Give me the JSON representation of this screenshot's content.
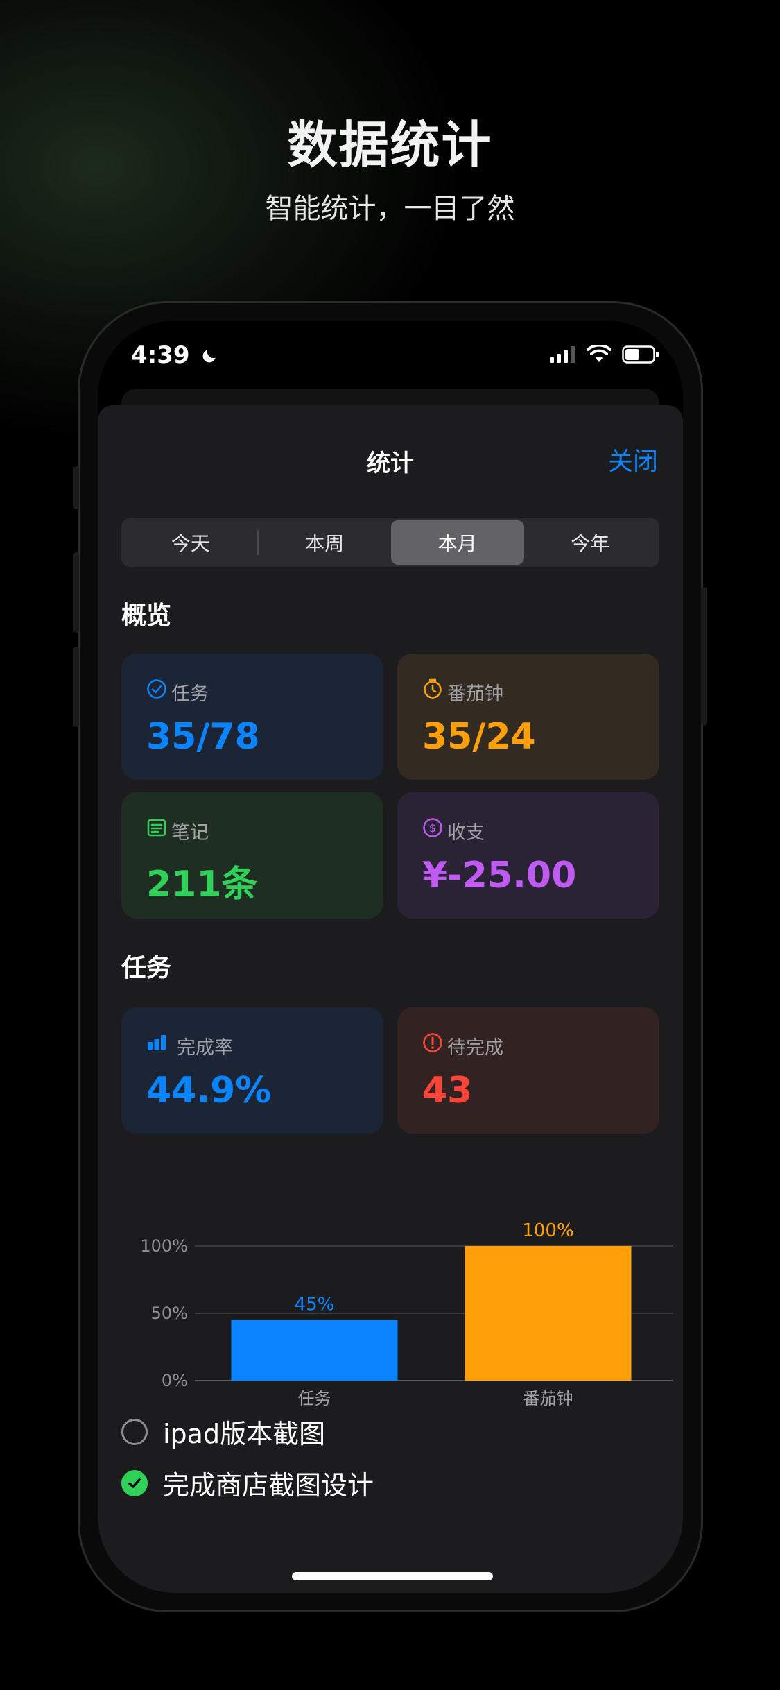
{
  "hero": {
    "title": "数据统计",
    "subtitle": "智能统计，一目了然"
  },
  "status": {
    "time": "4:39"
  },
  "nav": {
    "title": "统计",
    "close": "关闭"
  },
  "segments": [
    {
      "label": "今天",
      "active": false
    },
    {
      "label": "本周",
      "active": false
    },
    {
      "label": "本月",
      "active": true
    },
    {
      "label": "今年",
      "active": false
    }
  ],
  "overview": {
    "title": "概览",
    "cards": [
      {
        "label": "任务",
        "value": "35/78",
        "color": "#0a84ff",
        "bg": "#1b2535",
        "icon": "check-circle-icon"
      },
      {
        "label": "番茄钟",
        "value": "35/24",
        "color": "#ff9f0a",
        "bg": "#332b22",
        "icon": "timer-icon"
      },
      {
        "label": "笔记",
        "value": "211条",
        "color": "#30d158",
        "bg": "#1e2e22",
        "icon": "note-icon"
      },
      {
        "label": "收支",
        "value": "¥-25.00",
        "color": "#bf5af2",
        "bg": "#2a2235",
        "icon": "dollar-circle-icon"
      }
    ]
  },
  "tasks": {
    "title": "任务",
    "cards": [
      {
        "label": "完成率",
        "value": "44.9%",
        "color": "#0a84ff",
        "bg": "#1b2535",
        "icon": "bar-chart-icon"
      },
      {
        "label": "待完成",
        "value": "43",
        "color": "#ff453a",
        "bg": "#332222",
        "icon": "alert-circle-icon"
      }
    ]
  },
  "chart_data": {
    "type": "bar",
    "categories": [
      "任务",
      "番茄钟"
    ],
    "values": [
      45,
      100
    ],
    "value_labels": [
      "45%",
      "100%"
    ],
    "colors": [
      "#0a84ff",
      "#ff9f0a"
    ],
    "yticks": [
      "100%",
      "50%",
      "0%"
    ],
    "ylim": [
      0,
      100
    ],
    "grid": true
  },
  "todos": [
    {
      "text": "ipad版本截图",
      "done": false
    },
    {
      "text": "完成商店截图设计",
      "done": true
    }
  ]
}
